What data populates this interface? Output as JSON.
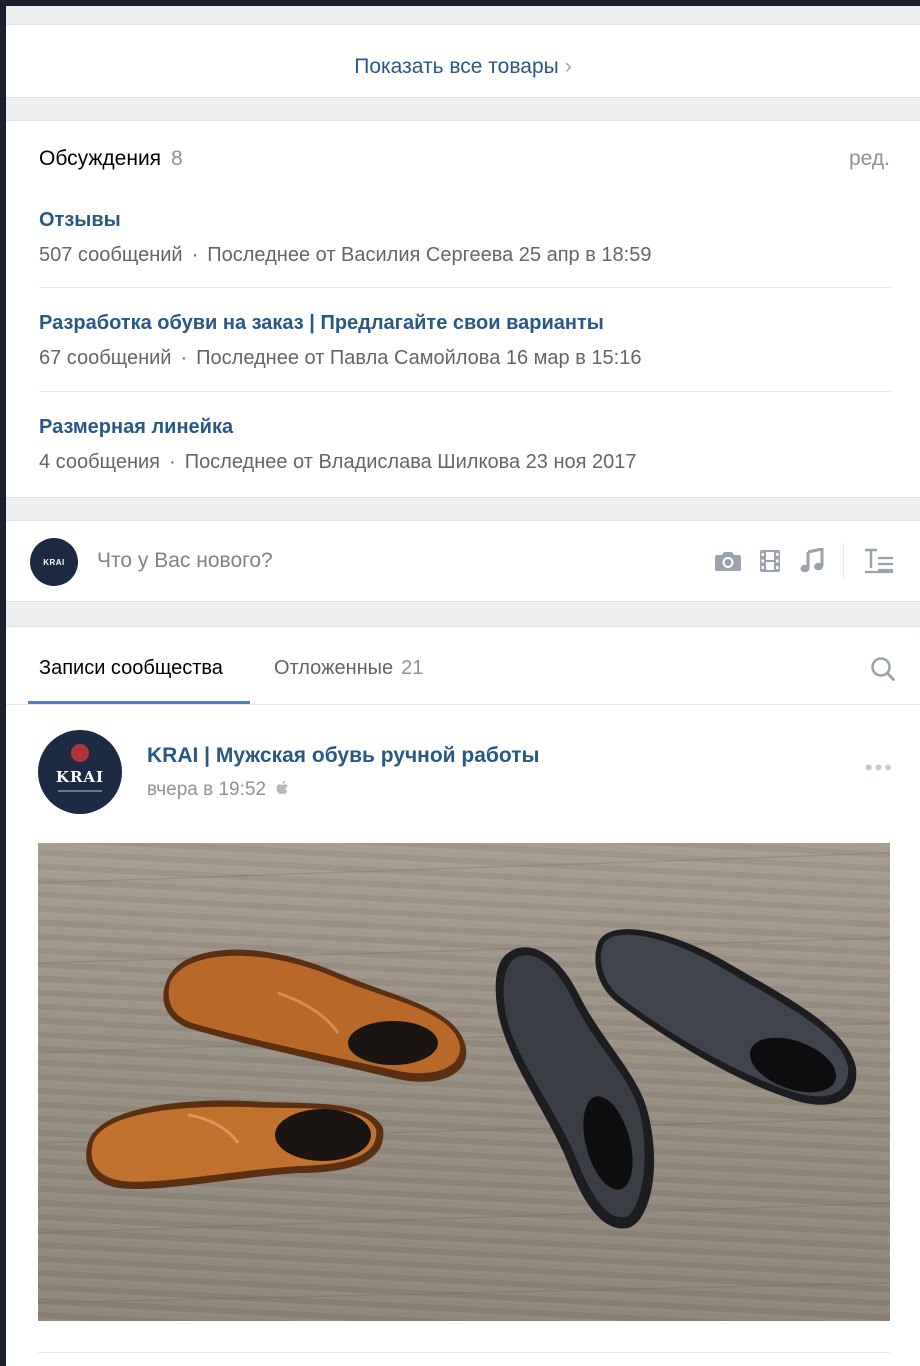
{
  "goods": {
    "show_all_label": "Показать все товары",
    "chevron": "›"
  },
  "discussions": {
    "title": "Обсуждения",
    "count": "8",
    "edit_label": "ред.",
    "topics": [
      {
        "title": "Отзывы",
        "messages": "507 сообщений",
        "last": "Последнее от Василия Сергеева 25 апр в 18:59"
      },
      {
        "title": "Разработка обуви на заказ | Предлагайте свои варианты",
        "messages": "67 сообщений",
        "last": "Последнее от Павла Самойлова 16 мар в 15:16"
      },
      {
        "title": "Размерная линейка",
        "messages": "4 сообщения",
        "last": "Последнее от Владислава Шилкова 23 ноя 2017"
      }
    ],
    "separator": "·"
  },
  "composer": {
    "avatar_text": "KRAI",
    "placeholder": "Что у Вас нового?",
    "icons": [
      "camera-icon",
      "video-icon",
      "music-icon",
      "text-format-icon"
    ]
  },
  "feed": {
    "tabs": [
      {
        "label": "Записи сообщества"
      },
      {
        "label": "Отложенные",
        "count": "21"
      }
    ],
    "search_icon": "search-icon"
  },
  "post": {
    "avatar_text": "KRAI",
    "author": "KRAI | Мужская обувь ручной работы",
    "time": "вчера в 19:52",
    "platform_icon": "apple-icon",
    "more": "•••"
  },
  "colors": {
    "link": "#2a5885",
    "accent": "#5181b8",
    "muted": "#939393",
    "bg": "#edeef0"
  }
}
